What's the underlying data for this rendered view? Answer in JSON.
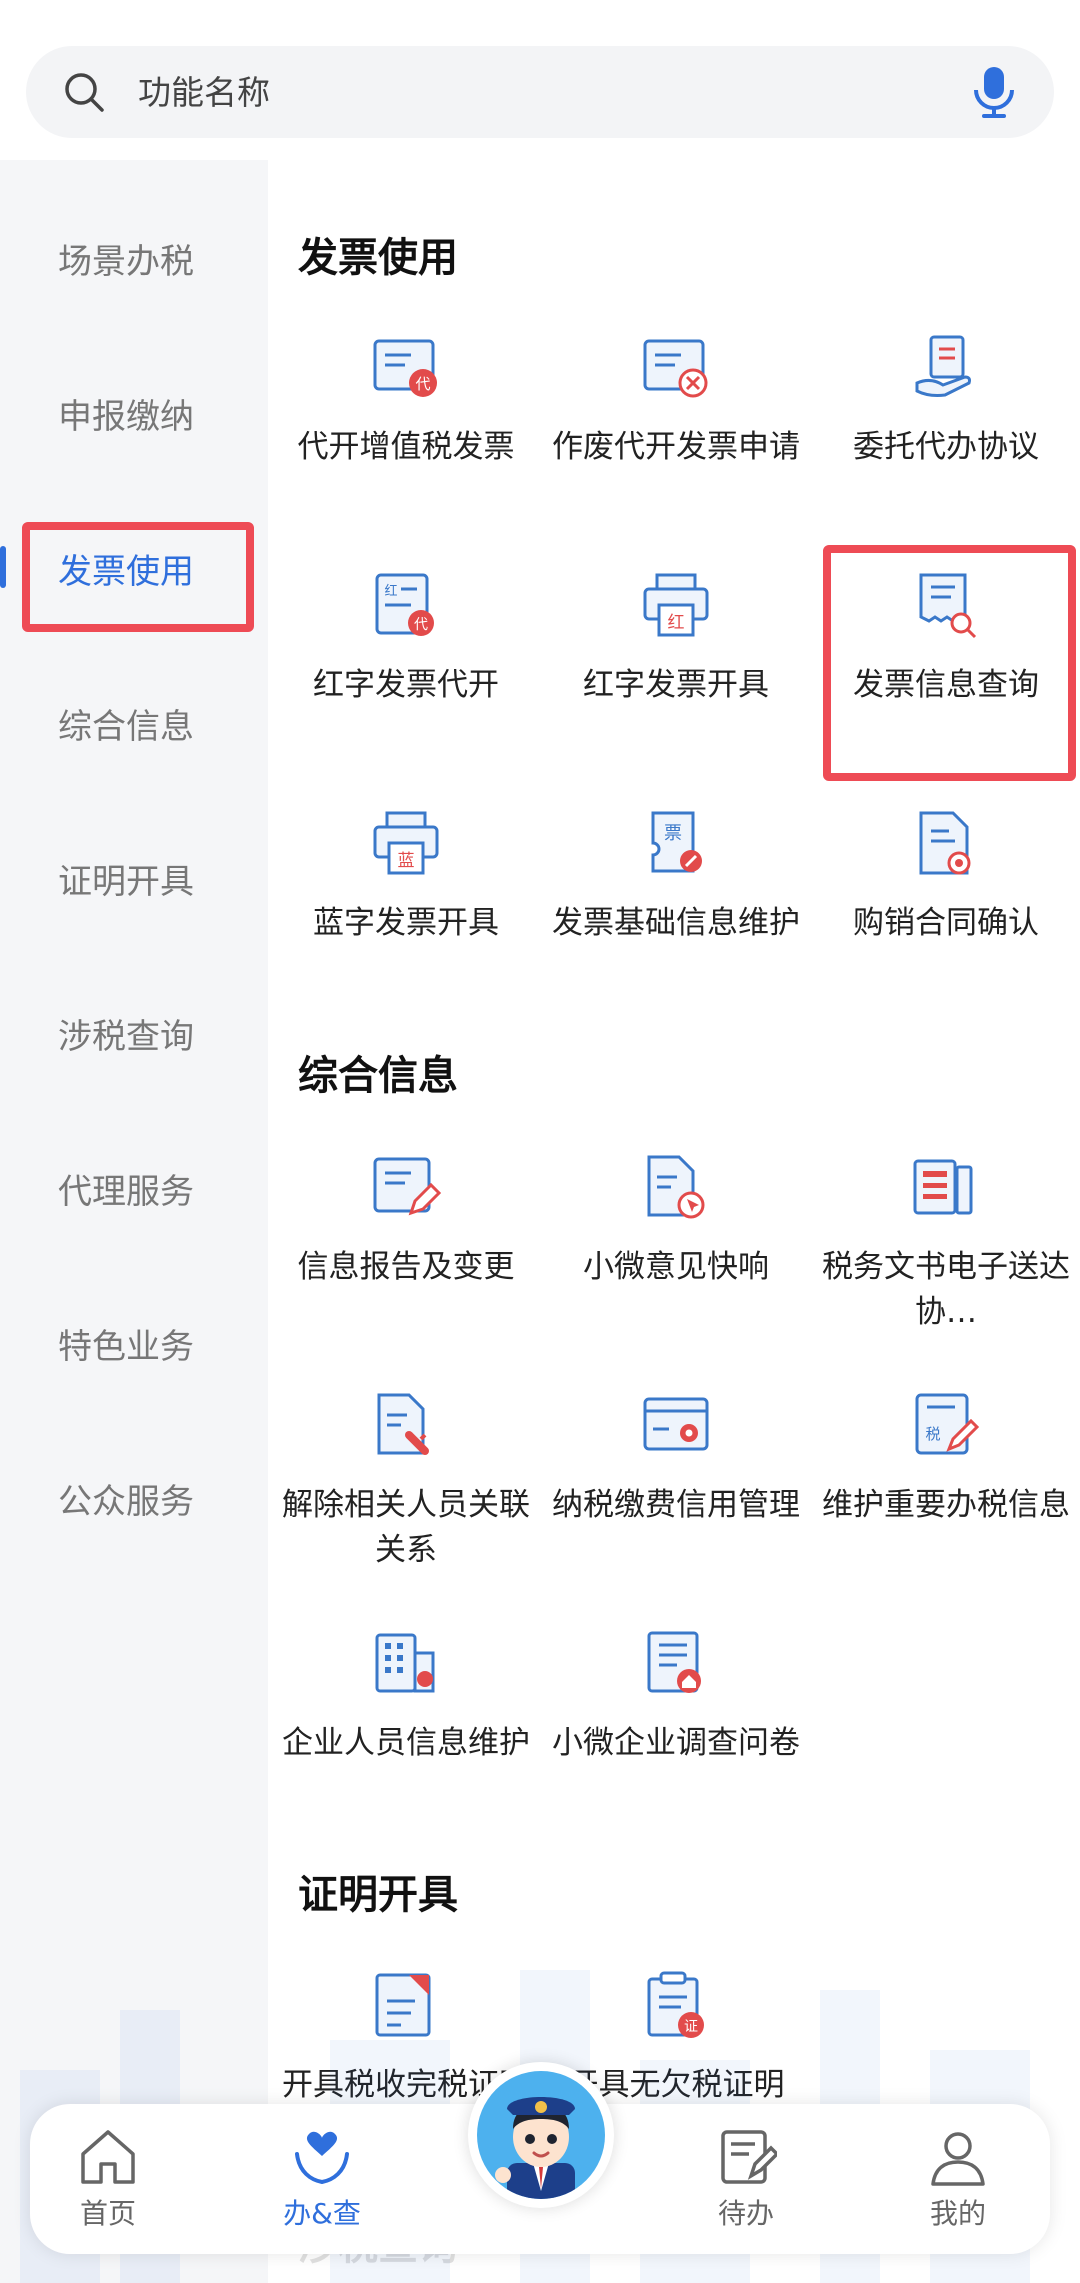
{
  "search": {
    "placeholder": "功能名称"
  },
  "sidebar": {
    "items": [
      {
        "label": "场景办税"
      },
      {
        "label": "申报缴纳"
      },
      {
        "label": "发票使用"
      },
      {
        "label": "综合信息"
      },
      {
        "label": "证明开具"
      },
      {
        "label": "涉税查询"
      },
      {
        "label": "代理服务"
      },
      {
        "label": "特色业务"
      },
      {
        "label": "公众服务"
      }
    ],
    "active": "发票使用"
  },
  "sections": [
    {
      "title": "发票使用",
      "tiles": [
        {
          "label": "代开增值税发票",
          "icon": "doc-dai-icon"
        },
        {
          "label": "作废代开发票申请",
          "icon": "doc-cancel-icon"
        },
        {
          "label": "委托代办协议",
          "icon": "hand-doc-icon"
        },
        {
          "label": "红字发票代开",
          "icon": "red-invoice-dai-icon"
        },
        {
          "label": "红字发票开具",
          "icon": "printer-red-icon"
        },
        {
          "label": "发票信息查询",
          "icon": "invoice-search-icon"
        },
        {
          "label": "蓝字发票开具",
          "icon": "printer-blue-icon"
        },
        {
          "label": "发票基础信息维护",
          "icon": "ticket-wrench-icon"
        },
        {
          "label": "购销合同确认",
          "icon": "contract-check-icon"
        }
      ]
    },
    {
      "title": "综合信息",
      "tiles": [
        {
          "label": "信息报告及变更",
          "icon": "report-edit-icon"
        },
        {
          "label": "小微意见快响",
          "icon": "doc-cursor-icon"
        },
        {
          "label": "税务文书电子送达协…",
          "icon": "documents-icon"
        },
        {
          "label": "解除相关人员关联关系",
          "icon": "doc-unlink-icon"
        },
        {
          "label": "纳税缴费信用管理",
          "icon": "card-gear-icon"
        },
        {
          "label": "维护重要办税信息",
          "icon": "tax-edit-icon"
        },
        {
          "label": "企业人员信息维护",
          "icon": "building-person-icon"
        },
        {
          "label": "小微企业调查问卷",
          "icon": "survey-home-icon"
        }
      ]
    },
    {
      "title": "证明开具",
      "tiles": [
        {
          "label": "开具税收完税证明",
          "icon": "tax-cert-icon"
        },
        {
          "label": "开具无欠税证明",
          "icon": "clipboard-zheng-icon"
        }
      ]
    }
  ],
  "next_section_peek": "涉税查询",
  "bottom_nav": {
    "items": [
      {
        "label": "首页",
        "icon": "home-icon"
      },
      {
        "label": "办&查",
        "icon": "heart-hands-icon"
      },
      {
        "label": "待办",
        "icon": "todo-icon"
      },
      {
        "label": "我的",
        "icon": "user-icon"
      }
    ],
    "active": "办&查"
  },
  "colors": {
    "accent": "#2f6fdc",
    "highlight": "#ee4b55",
    "icon_blue": "#3a78c9",
    "icon_red": "#e24b4b"
  }
}
